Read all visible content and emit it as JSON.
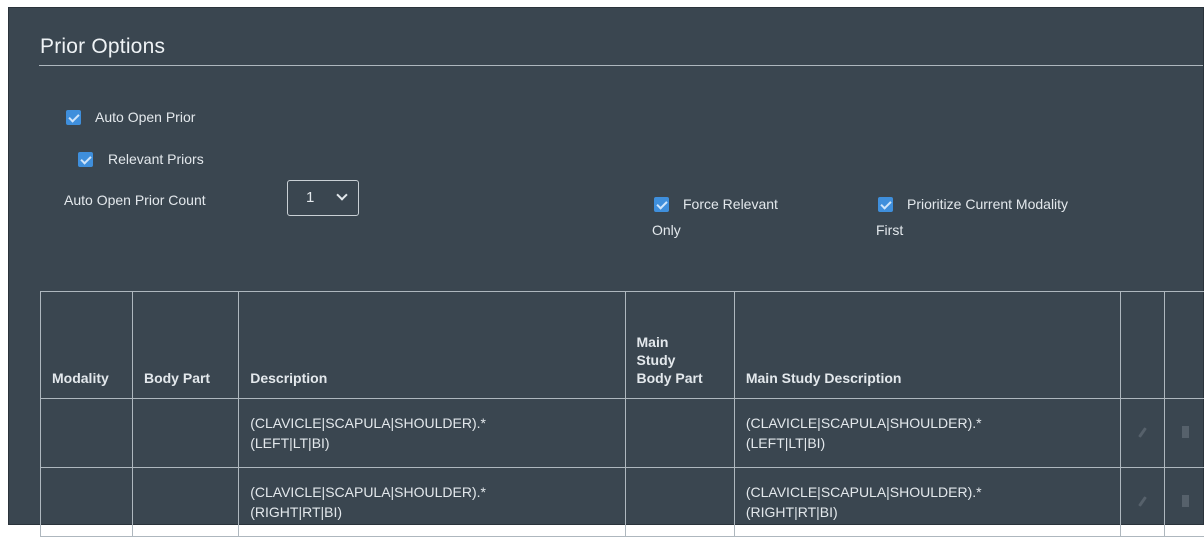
{
  "section": {
    "title": "Prior Options"
  },
  "options": {
    "auto_open_prior": {
      "label": "Auto Open Prior",
      "checked": true
    },
    "relevant_priors": {
      "label": "Relevant Priors",
      "checked": true
    },
    "auto_open_prior_count": {
      "label": "Auto Open Prior Count",
      "value": "1"
    },
    "force_relevant_only": {
      "label_line1": "Force Relevant",
      "label_line2": "Only",
      "checked": true
    },
    "prioritize_current_modality": {
      "label_line1": "Prioritize Current Modality",
      "label_line2": "First",
      "checked": true
    }
  },
  "table": {
    "headers": {
      "modality": "Modality",
      "body_part": "Body Part",
      "description": "Description",
      "main_study_body_part_l1": "Main",
      "main_study_body_part_l2": "Study",
      "main_study_body_part_l3": "Body Part",
      "main_study_description": "Main Study Description"
    },
    "rows": [
      {
        "modality": "",
        "body_part": "",
        "description_l1": "(CLAVICLE|SCAPULA|SHOULDER).*",
        "description_l2": "(LEFT|LT|BI)",
        "main_study_body_part": "",
        "main_description_l1": "(CLAVICLE|SCAPULA|SHOULDER).*",
        "main_description_l2": "(LEFT|LT|BI)"
      },
      {
        "modality": "",
        "body_part": "",
        "description_l1": "(CLAVICLE|SCAPULA|SHOULDER).*",
        "description_l2": "(RIGHT|RT|BI)",
        "main_study_body_part": "",
        "main_description_l1": "(CLAVICLE|SCAPULA|SHOULDER).*",
        "main_description_l2": "(RIGHT|RT|BI)"
      }
    ]
  },
  "icons": {
    "edit": "pencil-icon",
    "delete": "trash-icon"
  },
  "colors": {
    "panel_bg": "#3a4650",
    "checkbox": "#3f8fdc",
    "border": "#aeb7be"
  }
}
